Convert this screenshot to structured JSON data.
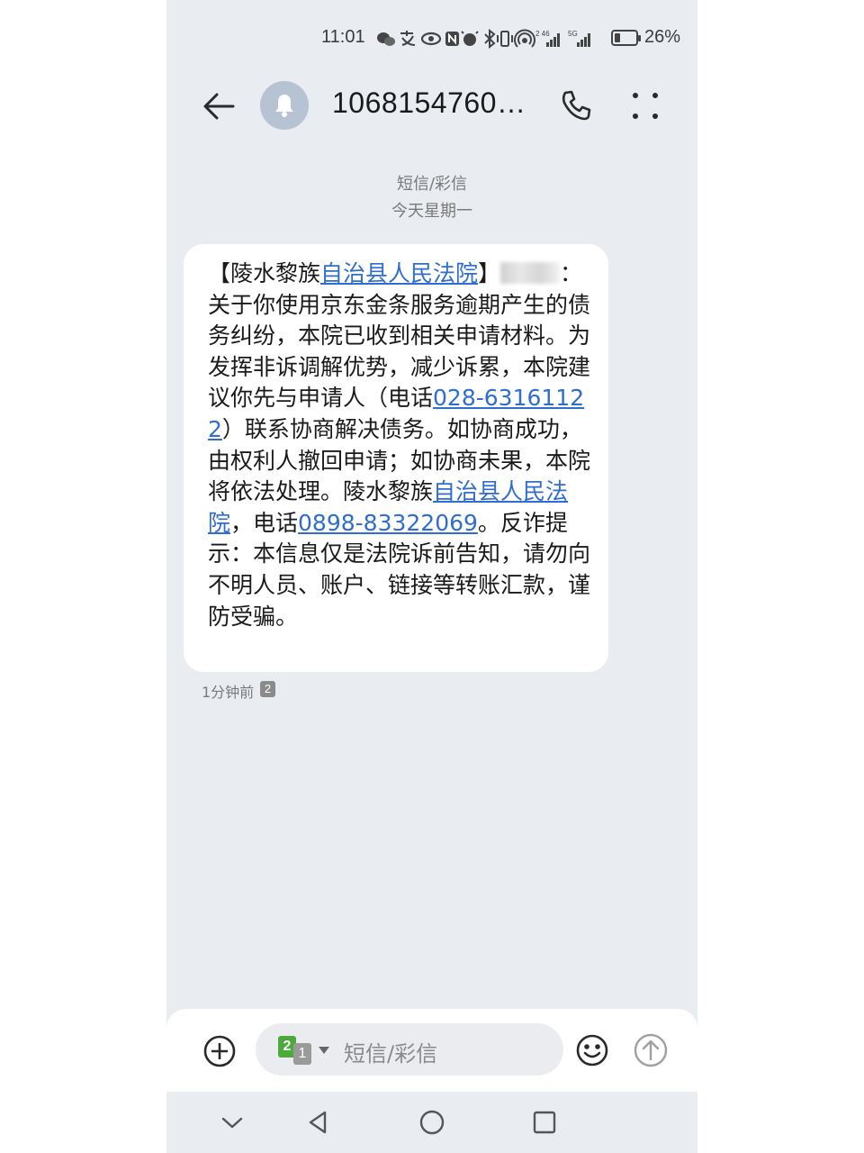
{
  "status_bar": {
    "time": "11:01",
    "battery_percent": "26%",
    "battery_level": 0.26,
    "icons": [
      "wechat-icon",
      "alipay-icon",
      "eye-icon",
      "nfc-icon",
      "alarm-icon",
      "bluetooth-icon",
      "vibrate-icon",
      "hotspot-icon",
      "signal-4g-icon",
      "signal-5g-icon",
      "battery-icon"
    ]
  },
  "header": {
    "sender": "1068154760…",
    "avatar_icon": "bell-icon",
    "back_icon": "arrow-left-icon",
    "call_icon": "phone-icon",
    "more_icon": "more-dots-icon"
  },
  "conversation": {
    "channel": "短信/彩信",
    "date": "今天星期一"
  },
  "message": {
    "part1": "【陵水黎族",
    "link1": "自治县人民法院",
    "part2": "】",
    "redacted_name": "",
    "part3": "：关于你使用京东金条服务逾期产生的债务纠纷，本院已收到相关申请材料。为发挥非诉调解优势，减少诉累，本院建议你先与申请人（电话",
    "phone1": "028-63161122",
    "part4": "）联系协商解决债务。如协商成功，由权利人撤回申请；如协商未果，本院将依法处理。陵水黎族",
    "link2": "自治县人民法院",
    "part5": "，电话",
    "phone2": "0898-83322069",
    "part6": "。反诈提示：本信息仅是法院诉前告知，请勿向不明人员、账户、链接等转账汇款，谨防受骗。",
    "time": "1分钟前",
    "sim": "2"
  },
  "composer": {
    "sim_primary": "2",
    "sim_secondary": "1",
    "placeholder": "短信/彩信",
    "attach_icon": "plus-circle-icon",
    "emoji_icon": "smiley-icon",
    "send_icon": "send-arrow-icon"
  },
  "nav_bar": {
    "icons": [
      "chevron-down-icon",
      "back-triangle-icon",
      "home-circle-icon",
      "recents-square-icon"
    ]
  },
  "colors": {
    "background": "#e9ecf1",
    "bubble": "#ffffff",
    "link": "#2f6dd1",
    "sim2": "#4caa3c"
  }
}
